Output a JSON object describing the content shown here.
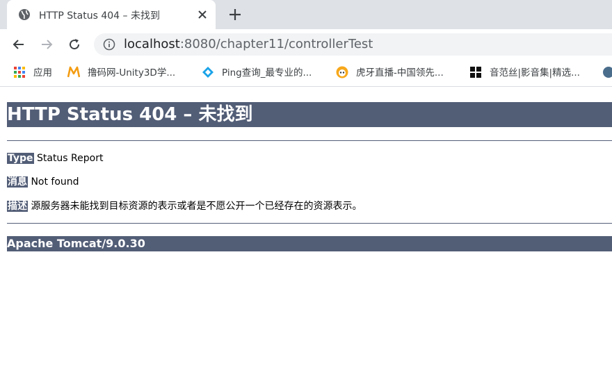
{
  "tab": {
    "title": "HTTP Status 404 – 未找到",
    "favicon": "globe-icon"
  },
  "toolbar": {
    "url_host": "localhost",
    "url_rest": ":8080/chapter11/controllerTest"
  },
  "bookmarks": [
    {
      "label": "应用",
      "icon": "apps-grid-icon"
    },
    {
      "label": "撸码网-Unity3D学...",
      "icon": "m-logo-icon"
    },
    {
      "label": "Ping查询_最专业的...",
      "icon": "ping-diamond-icon"
    },
    {
      "label": "虎牙直播-中国领先...",
      "icon": "huya-icon"
    },
    {
      "label": "音范丝|影音集|精选...",
      "icon": "squares-icon"
    }
  ],
  "page": {
    "heading": "HTTP Status 404 – 未找到",
    "type_label": "Type",
    "type_value": "Status Report",
    "message_label": "消息",
    "message_value": "Not found",
    "desc_label": "描述",
    "desc_value": "源服务器未能找到目标资源的表示或者是不愿公开一个已经存在的资源表示。",
    "footer": "Apache Tomcat/9.0.30"
  },
  "colors": {
    "tomcat_header": "#525d76",
    "tabstrip": "#dee1e6",
    "omnibox": "#f1f3f4"
  }
}
